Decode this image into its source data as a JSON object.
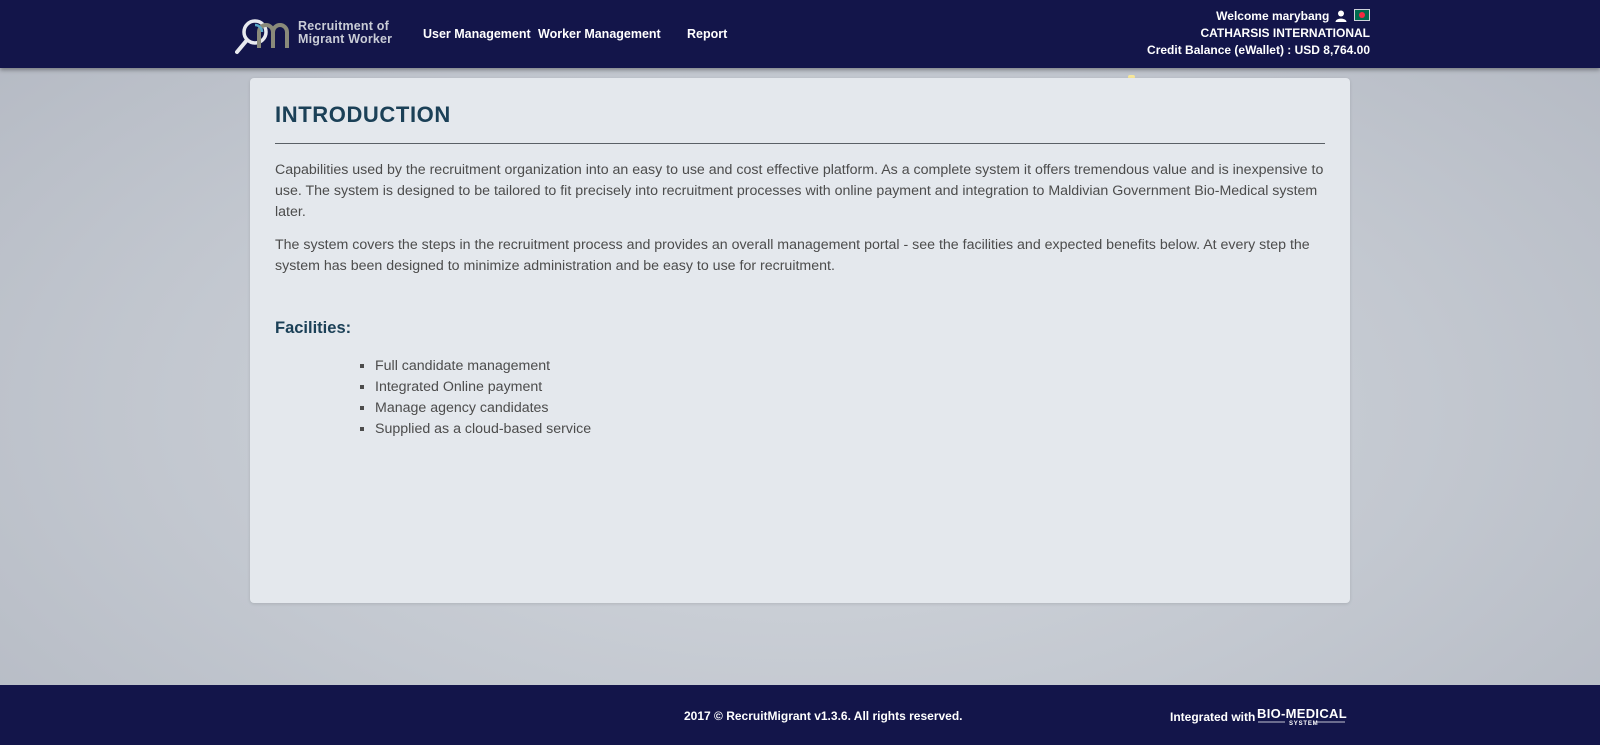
{
  "header": {
    "logo": {
      "line1": "Recruitment of",
      "line2": "Migrant Worker",
      "icon": "magnifier-rm-logo"
    },
    "nav": [
      {
        "label": "User Management"
      },
      {
        "label": "Worker Management"
      },
      {
        "label": "Report"
      }
    ],
    "user": {
      "welcome": "Welcome marybang",
      "user_icon": "person-icon",
      "flag_icon": "bangladesh-flag-icon",
      "company": "CATHARSIS INTERNATIONAL",
      "credit": "Credit Balance (eWallet) : USD 8,764.00"
    }
  },
  "intro": {
    "title": "INTRODUCTION",
    "paragraphs": [
      "Capabilities used by the recruitment organization into an easy to use and cost effective platform. As a complete system it offers tremendous value and is inexpensive to use. The system is designed to be tailored to fit precisely into recruitment processes with online payment and integration to Maldivian Government Bio-Medical system later.",
      "The system covers the steps in the recruitment process and provides an overall management portal - see the facilities and expected benefits below. At every step the system has been designed to minimize administration and be easy to use for recruitment."
    ],
    "facilities_title": "Facilities:",
    "facilities": [
      "Full candidate management",
      "Integrated Online payment",
      "Manage agency candidates",
      "Supplied as a cloud-based service"
    ]
  },
  "footer": {
    "copyright": "2017 © RecruitMigrant v1.3.6. All rights reserved.",
    "integrated_label": "Integrated with",
    "partner_logo_text": "BIO-MEDICAL",
    "partner_logo_subtext": "SYSTEM"
  },
  "colors": {
    "header_bg": "#13154a",
    "footer_bg": "#13154a",
    "card_bg": "#e4e8ed",
    "heading": "#1b4057",
    "body_text": "#4c4c4c"
  }
}
